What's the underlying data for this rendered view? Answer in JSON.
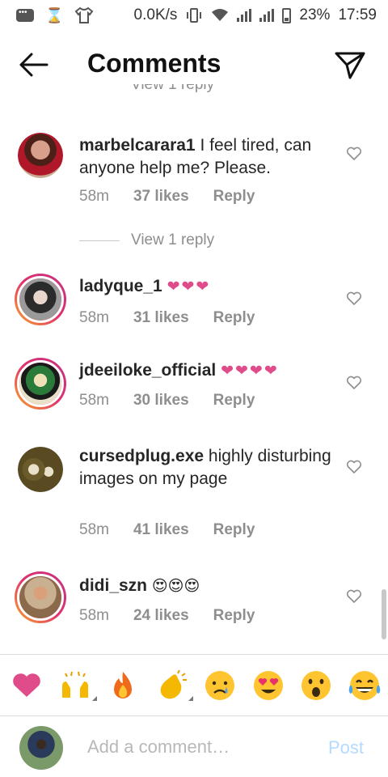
{
  "status_bar": {
    "speed": "0.0K/s",
    "battery": "23%",
    "time": "17:59"
  },
  "header": {
    "title": "Comments"
  },
  "partial_reply": "View 1 reply",
  "comments": [
    {
      "username": "marbelcarara1",
      "text": "I feel tired, can anyone help me? Please.",
      "time": "58m",
      "likes": "37 likes",
      "reply": "Reply"
    },
    {
      "username": "ladyque_1",
      "text": "❤❤❤",
      "time": "58m",
      "likes": "31 likes",
      "reply": "Reply"
    },
    {
      "username": "jdeeiloke_official",
      "text": "❤❤❤❤",
      "time": "58m",
      "likes": "30 likes",
      "reply": "Reply"
    },
    {
      "username": "cursedplug.exe",
      "text": "highly disturbing images on my page",
      "time": "58m",
      "likes": "41 likes",
      "reply": "Reply"
    },
    {
      "username": "didi_szn",
      "text": "😍😍😍",
      "time": "58m",
      "likes": "24 likes",
      "reply": "Reply"
    }
  ],
  "view_reply": "View 1 reply",
  "emoji_bar": [
    "❤️",
    "🙌",
    "🔥",
    "👏",
    "😢",
    "😍",
    "😮",
    "😂"
  ],
  "composer": {
    "placeholder": "Add a comment…",
    "post_label": "Post"
  },
  "colors": {
    "heart_emoji": "#e04c8a",
    "post_disabled": "#b3dbff",
    "meta_gray": "#8e8e8e"
  }
}
